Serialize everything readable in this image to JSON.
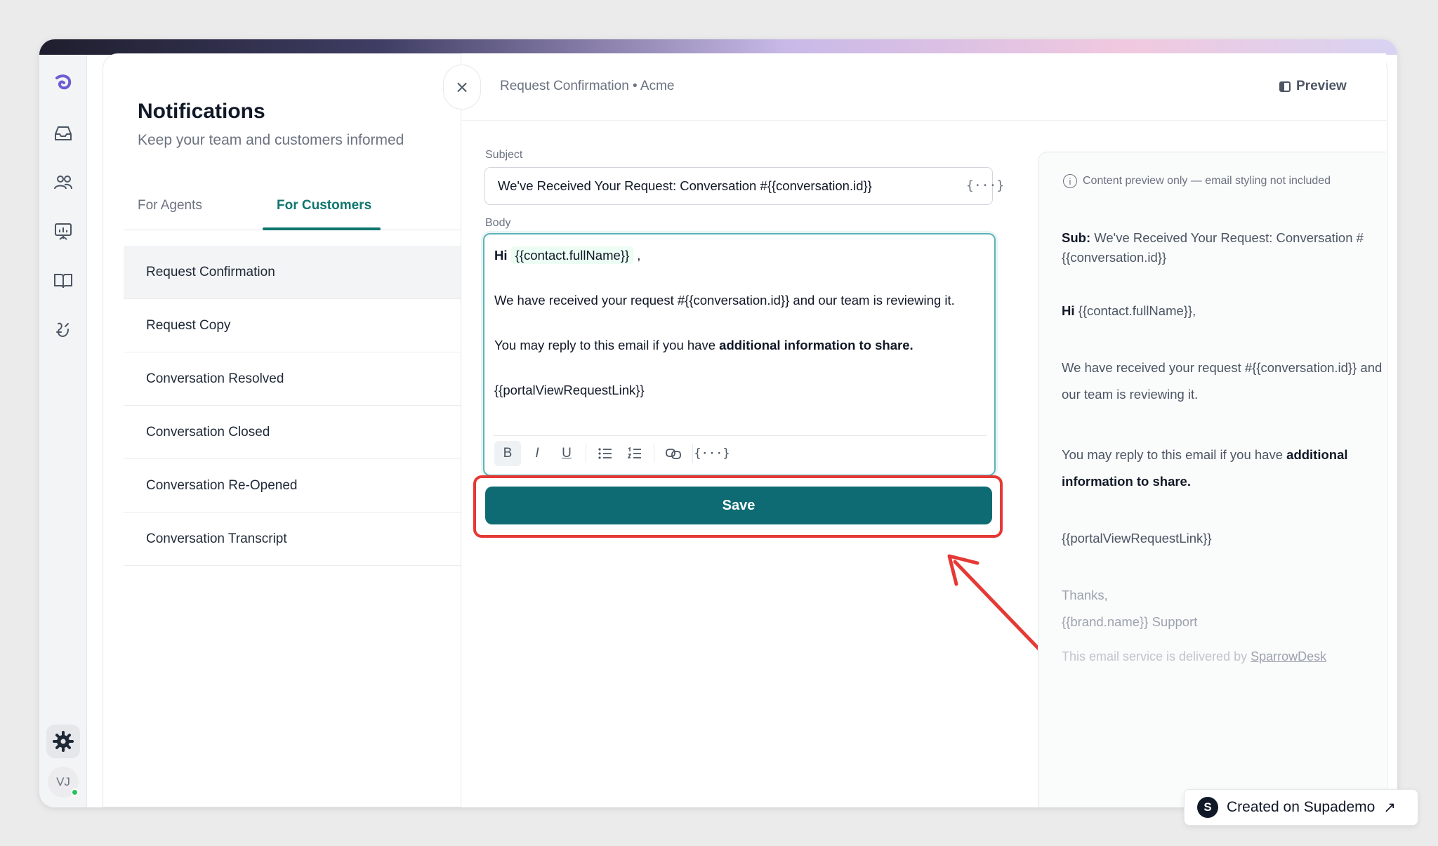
{
  "sidebar": {
    "icons": [
      "brand-logo-icon",
      "inbox-icon",
      "users-icon",
      "reports-icon",
      "knowledge-base-icon",
      "automation-icon",
      "settings-icon"
    ],
    "avatar_initials": "VJ"
  },
  "notifications": {
    "title": "Notifications",
    "subtitle": "Keep your team and customers informed",
    "tabs": [
      {
        "label": "For Agents",
        "active": false
      },
      {
        "label": "For Customers",
        "active": true
      }
    ],
    "items": [
      {
        "label": "Request Confirmation",
        "selected": true
      },
      {
        "label": "Request Copy",
        "selected": false
      },
      {
        "label": "Conversation Resolved",
        "selected": false
      },
      {
        "label": "Conversation Closed",
        "selected": false
      },
      {
        "label": "Conversation Re-Opened",
        "selected": false
      },
      {
        "label": "Conversation Transcript",
        "selected": false
      }
    ]
  },
  "editor": {
    "close_symbol": "×",
    "title": "Request Confirmation • Acme",
    "preview_label": "Preview",
    "subject_label": "Subject",
    "subject_value": "We've Received Your Request: Conversation #{{conversation.id}}",
    "variable_symbol": "{···}",
    "body_label": "Body",
    "body": {
      "greeting": "Hi",
      "contact_var": "{{contact.fullName}}",
      "greeting_suffix": " ,",
      "line1": "We have received your request #{{conversation.id}} and our team is reviewing it.",
      "line2_plain": "You may reply to this email if you have ",
      "line2_bold": "additional information to share.",
      "line3": "{{portalViewRequestLink}}"
    },
    "toolbar": [
      "B",
      "I",
      "U"
    ],
    "save_label": "Save"
  },
  "preview": {
    "note": "Content preview only — email styling not included",
    "info_symbol": "i",
    "sub_label": "Sub:",
    "sub_value": " We've Received Your Request: Conversation #{{conversation.id}}",
    "hi": "Hi",
    "hi_var": " {{contact.fullName}},",
    "line1": "We have received your request #{{conversation.id}} and our team is reviewing it.",
    "line2_plain": "You may reply to this email if you have ",
    "line2_bold": "additional information to share.",
    "line3": "{{portalViewRequestLink}}",
    "thanks": "Thanks,",
    "signature": "{{brand.name}} Support",
    "footer_prefix": "This email service is delivered by ",
    "footer_link": "SparrowDesk"
  },
  "badge": {
    "logo_letter": "S",
    "label": "Created on Supademo",
    "arrow": "↗"
  },
  "colors": {
    "accent": "#0f6b73",
    "tab_active": "#0f766e",
    "highlight": "#e53935",
    "focus_border": "#5eb3b8"
  }
}
